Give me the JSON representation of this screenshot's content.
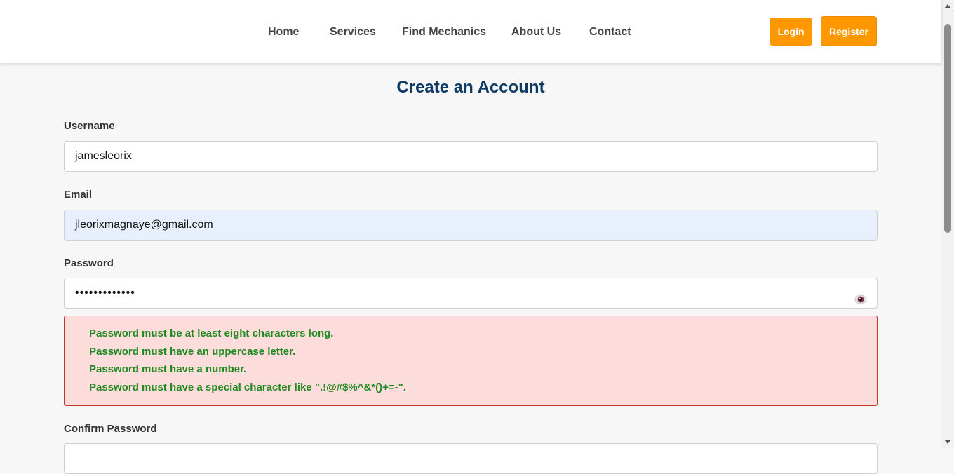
{
  "nav": {
    "links": [
      "Home",
      "Services",
      "Find Mechanics",
      "About Us",
      "Contact"
    ],
    "login_label": "Login",
    "register_label": "Register"
  },
  "form": {
    "title": "Create an Account",
    "username": {
      "label": "Username",
      "value": "jamesleorix"
    },
    "email": {
      "label": "Email",
      "value": "jleorixmagnaye@gmail.com"
    },
    "password": {
      "label": "Password",
      "value": "•••••••••••••"
    },
    "password_errors": [
      "Password must be at least eight characters long.",
      "Password must have an uppercase letter.",
      "Password must have a number.",
      "Password must have a special character like \".!@#$%^&*()+=-\"."
    ],
    "confirm_password": {
      "label": "Confirm Password",
      "value": ""
    }
  },
  "colors": {
    "accent": "#ff9800",
    "title": "#0d3b66",
    "error_bg": "#fddcdc",
    "error_border": "#c0392b",
    "error_text": "#1f8a1f",
    "autofill_bg": "#e8f0fe"
  },
  "icons": {
    "password_toggle": "eye-icon"
  }
}
